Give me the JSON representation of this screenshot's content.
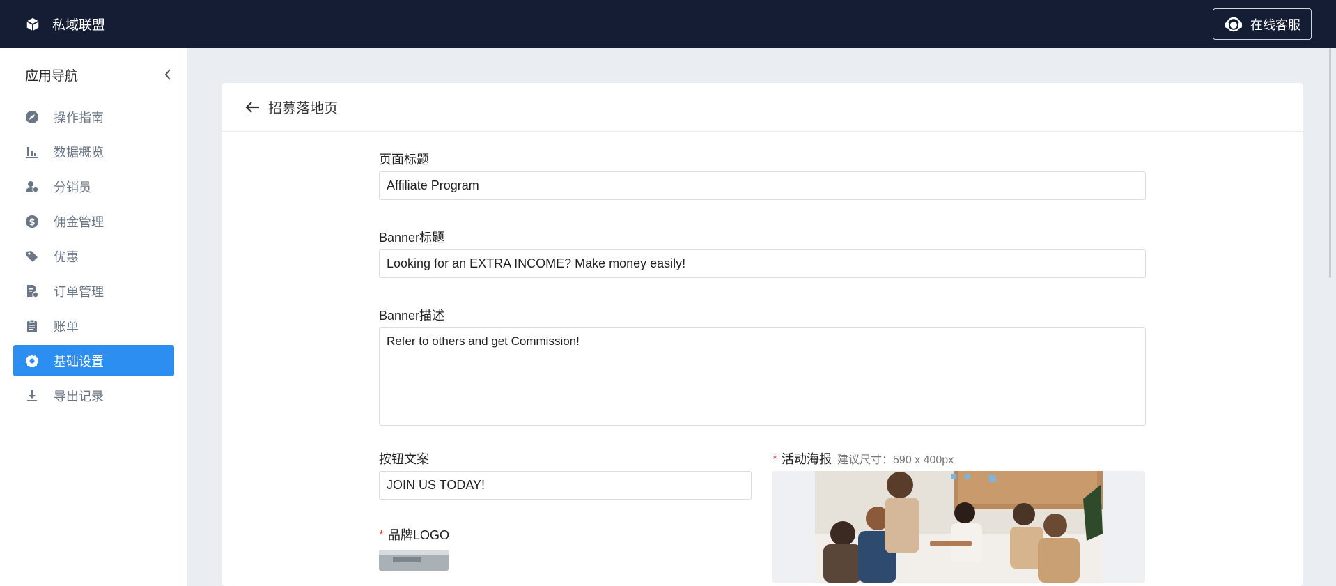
{
  "app": {
    "brand_name": "私域联盟",
    "support_label": "在线客服"
  },
  "sidebar": {
    "title": "应用导航",
    "items": [
      {
        "label": "操作指南",
        "icon": "compass-icon",
        "active": false
      },
      {
        "label": "数据概览",
        "icon": "bar-chart-icon",
        "active": false
      },
      {
        "label": "分销员",
        "icon": "users-icon",
        "active": false
      },
      {
        "label": "佣金管理",
        "icon": "dollar-icon",
        "active": false
      },
      {
        "label": "优惠",
        "icon": "tag-icon",
        "active": false
      },
      {
        "label": "订单管理",
        "icon": "order-doc-icon",
        "active": false
      },
      {
        "label": "账单",
        "icon": "clipboard-icon",
        "active": false
      },
      {
        "label": "基础设置",
        "icon": "gear-icon",
        "active": true
      },
      {
        "label": "导出记录",
        "icon": "download-icon",
        "active": false
      }
    ]
  },
  "page": {
    "title": "招募落地页",
    "fields": {
      "page_title": {
        "label": "页面标题",
        "value": "Affiliate Program"
      },
      "banner_title": {
        "label": "Banner标题",
        "value": "Looking for an EXTRA INCOME? Make money easily!"
      },
      "banner_desc": {
        "label": "Banner描述",
        "value": "Refer to others and get Commission!"
      },
      "button_text": {
        "label": "按钮文案",
        "value": "JOIN US TODAY!"
      },
      "brand_logo": {
        "label": "品牌LOGO",
        "required_mark": "*"
      },
      "poster": {
        "label": "活动海报",
        "required_mark": "*",
        "hint": "建议尺寸：590 x 400px"
      }
    }
  },
  "colors": {
    "topbar": "#141d34",
    "accent": "#2b8ef0",
    "required": "#e5484d"
  }
}
